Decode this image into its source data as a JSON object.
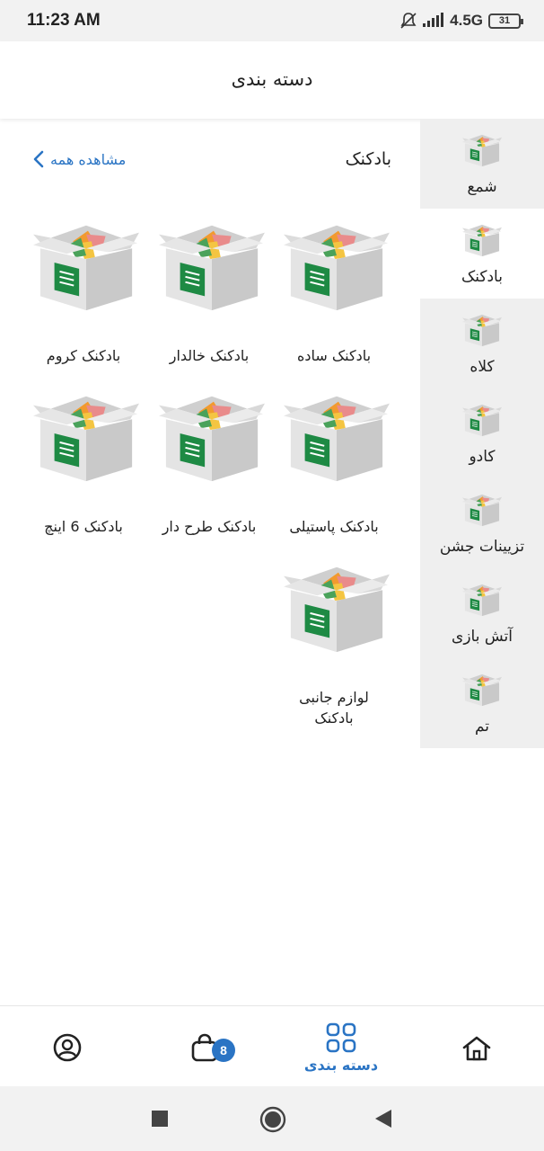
{
  "status": {
    "time": "11:23 AM",
    "network": "4.5G",
    "battery": "31"
  },
  "header": {
    "title": "دسته بندی"
  },
  "sidebar": {
    "items": [
      {
        "label": "شمع",
        "active": false
      },
      {
        "label": "بادکنک",
        "active": true
      },
      {
        "label": "کلاه",
        "active": false
      },
      {
        "label": "کادو",
        "active": false
      },
      {
        "label": "تزیینات جشن",
        "active": false
      },
      {
        "label": "آتش بازی",
        "active": false
      },
      {
        "label": "تم",
        "active": false
      }
    ]
  },
  "main": {
    "section_title": "بادکنک",
    "see_all": "مشاهده همه",
    "products": [
      {
        "label": "بادکنک ساده"
      },
      {
        "label": "بادکنک خالدار"
      },
      {
        "label": "بادکنک کروم"
      },
      {
        "label": "بادکنک پاستیلی"
      },
      {
        "label": "بادکنک طرح دار"
      },
      {
        "label": "بادکنک 6 اینچ"
      },
      {
        "label": "لوازم جانبی بادکنک"
      }
    ]
  },
  "bottom_nav": {
    "categories_label": "دسته بندی",
    "cart_badge": "8"
  },
  "colors": {
    "accent": "#2a74c4",
    "sidebar_bg": "#efefef",
    "box_green": "#1e8a44"
  }
}
